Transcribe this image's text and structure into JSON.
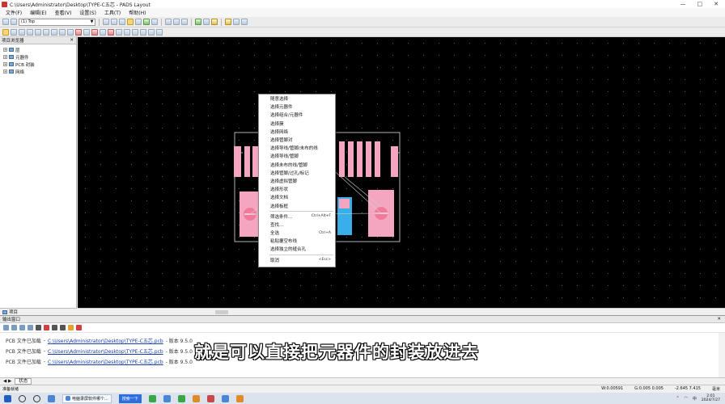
{
  "window": {
    "title": "C:\\Users\\Administrator\\Desktop\\TYPE-C五芯 - PADS Layout",
    "controls": [
      "—",
      "□",
      "✕"
    ]
  },
  "menubar": {
    "items": [
      "文件(F)",
      "编辑(E)",
      "查看(V)",
      "设置(S)",
      "工具(T)",
      "帮助(H)"
    ]
  },
  "toolbar": {
    "layer_select": "(1) Top"
  },
  "project_panel": {
    "title": "项目浏览器",
    "close": "✕",
    "tree": [
      "层",
      "元器件",
      "PCB 封装",
      "网络"
    ],
    "tab": "项目"
  },
  "context_menu": {
    "items": [
      {
        "label": "随意选择",
        "shortcut": ""
      },
      {
        "label": "选择元器件",
        "shortcut": ""
      },
      {
        "label": "选择组合/元器件",
        "shortcut": ""
      },
      {
        "label": "选择簇",
        "shortcut": ""
      },
      {
        "label": "选择网络",
        "shortcut": ""
      },
      {
        "label": "选择管脚对",
        "shortcut": ""
      },
      {
        "label": "选择导线/管脚/未布的线",
        "shortcut": ""
      },
      {
        "label": "选择导线/管脚",
        "shortcut": ""
      },
      {
        "label": "选择未布的线/管脚",
        "shortcut": ""
      },
      {
        "label": "选择管脚/过孔/标记",
        "shortcut": ""
      },
      {
        "label": "选择虚拟管脚",
        "shortcut": ""
      },
      {
        "label": "选择形状",
        "shortcut": ""
      },
      {
        "label": "选择文档",
        "shortcut": ""
      },
      {
        "label": "选择板框",
        "shortcut": ""
      },
      {
        "label": "筛选条件...",
        "shortcut": "Ctrl+Alt+F"
      },
      {
        "label": "查找...",
        "shortcut": ""
      },
      {
        "label": "全选",
        "shortcut": "Ctrl+A"
      },
      {
        "label": "粘贴覆空布线",
        "shortcut": ""
      },
      {
        "label": "选择独立的缝合孔",
        "shortcut": ""
      },
      {
        "label": "取消",
        "shortcut": "<Esc>"
      }
    ]
  },
  "output_panel": {
    "title": "输出窗口",
    "close": "✕",
    "lines": [
      {
        "prefix": "PCB 文件已加载",
        "path": "C:\\Users\\Administrator\\Desktop\\TYPE-C五芯.pcb",
        "suffix": "- 版本 9.5.0"
      },
      {
        "prefix": "PCB 文件已加载",
        "path": "C:\\Users\\Administrator\\Desktop\\TYPE-C五芯.pcb",
        "suffix": "- 版本 9.5.0"
      },
      {
        "prefix": "PCB 文件已加载",
        "path": "C:\\Users\\Administrator\\Desktop\\TYPE-C五芯.pcb",
        "suffix": "- 版本 9.5.0"
      }
    ],
    "tab": "状态"
  },
  "subtitle": "就是可以直接把元器件的封装放进去",
  "statusbar": {
    "left": "准备就绪",
    "width": "W:0.00591",
    "grid": "G:0.005 0.005",
    "coords": "-2.645   7.415",
    "unit": "毫米"
  },
  "taskbar": {
    "app1": "电脑录屏软件哪个...",
    "app2": "搜索一下",
    "ime": "中",
    "time": "2:01",
    "date": "2024/7/27"
  },
  "colors": {
    "pad_pink": "#f4a6c0",
    "pad_blue": "#3aaee8",
    "outline": "#e8e8e8",
    "canvas_bg": "#000000"
  }
}
